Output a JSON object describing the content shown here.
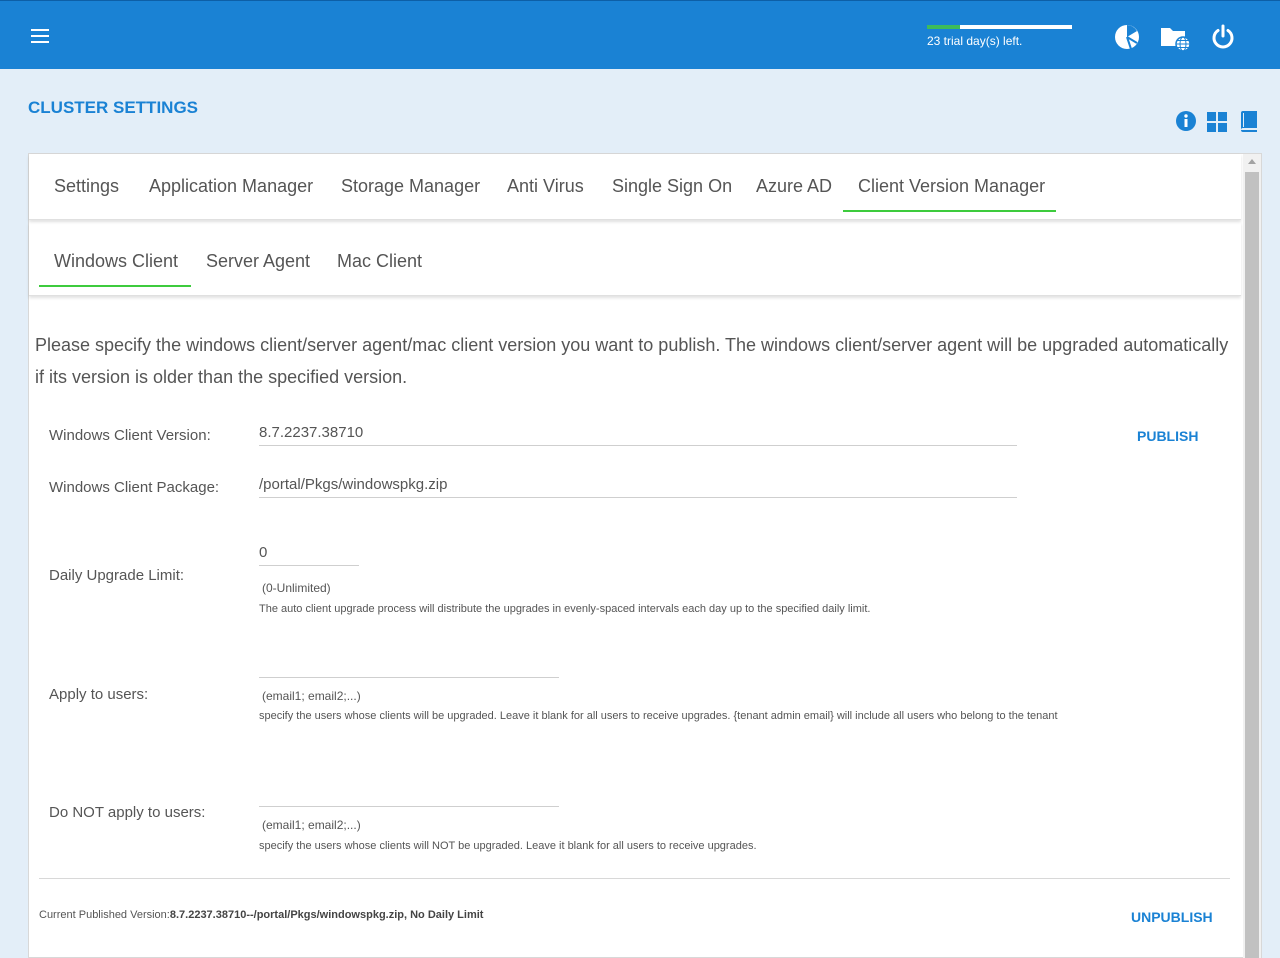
{
  "topbar": {
    "menu_icon": "hamburger-icon",
    "trial_text": "23 trial day(s) left.",
    "trial_progress": 0.23,
    "icons": [
      "dashboard-pie-icon",
      "folder-globe-icon",
      "power-icon"
    ]
  },
  "page": {
    "title": "CLUSTER SETTINGS",
    "header_icons": [
      "info-icon",
      "grid-icon",
      "book-icon"
    ]
  },
  "tabs": [
    {
      "label": "Settings"
    },
    {
      "label": "Application Manager"
    },
    {
      "label": "Storage Manager"
    },
    {
      "label": "Anti Virus"
    },
    {
      "label": "Single Sign On"
    },
    {
      "label": "Azure AD"
    },
    {
      "label": "Client Version Manager"
    }
  ],
  "subtabs": [
    {
      "label": "Windows Client"
    },
    {
      "label": "Server Agent"
    },
    {
      "label": "Mac Client"
    }
  ],
  "description": "Please specify the windows client/server agent/mac client version you want to publish. The windows client/server agent will be upgraded automatically if its version is older than the specified version.",
  "form": {
    "version_label": "Windows Client Version:",
    "version_value": "8.7.2237.38710",
    "package_label": "Windows Client Package:",
    "package_value": "/portal/Pkgs/windowspkg.zip",
    "daily_label": "Daily Upgrade Limit:",
    "daily_value": "0",
    "daily_hint": "(0-Unlimited)",
    "daily_help": "The auto client upgrade process will distribute the upgrades in evenly-spaced intervals each day up to the specified daily limit.",
    "apply_label": "Apply to users:",
    "apply_value": "",
    "apply_hint": "(email1; email2;...)",
    "apply_help": "specify the users whose clients will be upgraded. Leave it blank for all users to receive upgrades. {tenant admin email} will include all users who belong to the tenant",
    "notapply_label": "Do NOT apply to users:",
    "notapply_value": "",
    "notapply_hint": "(email1; email2;...)",
    "notapply_help": "specify the users whose clients will NOT be upgraded. Leave it blank for all users to receive upgrades.",
    "publish_label": "PUBLISH",
    "unpublish_label": "UNPUBLISH"
  },
  "current": {
    "label": "Current Published Version:",
    "value": "8.7.2237.38710--/portal/Pkgs/windowspkg.zip, No Daily Limit"
  },
  "colors": {
    "accent": "#1a82d4",
    "active_tab": "#3dcb3d",
    "background": "#e3eef8"
  }
}
